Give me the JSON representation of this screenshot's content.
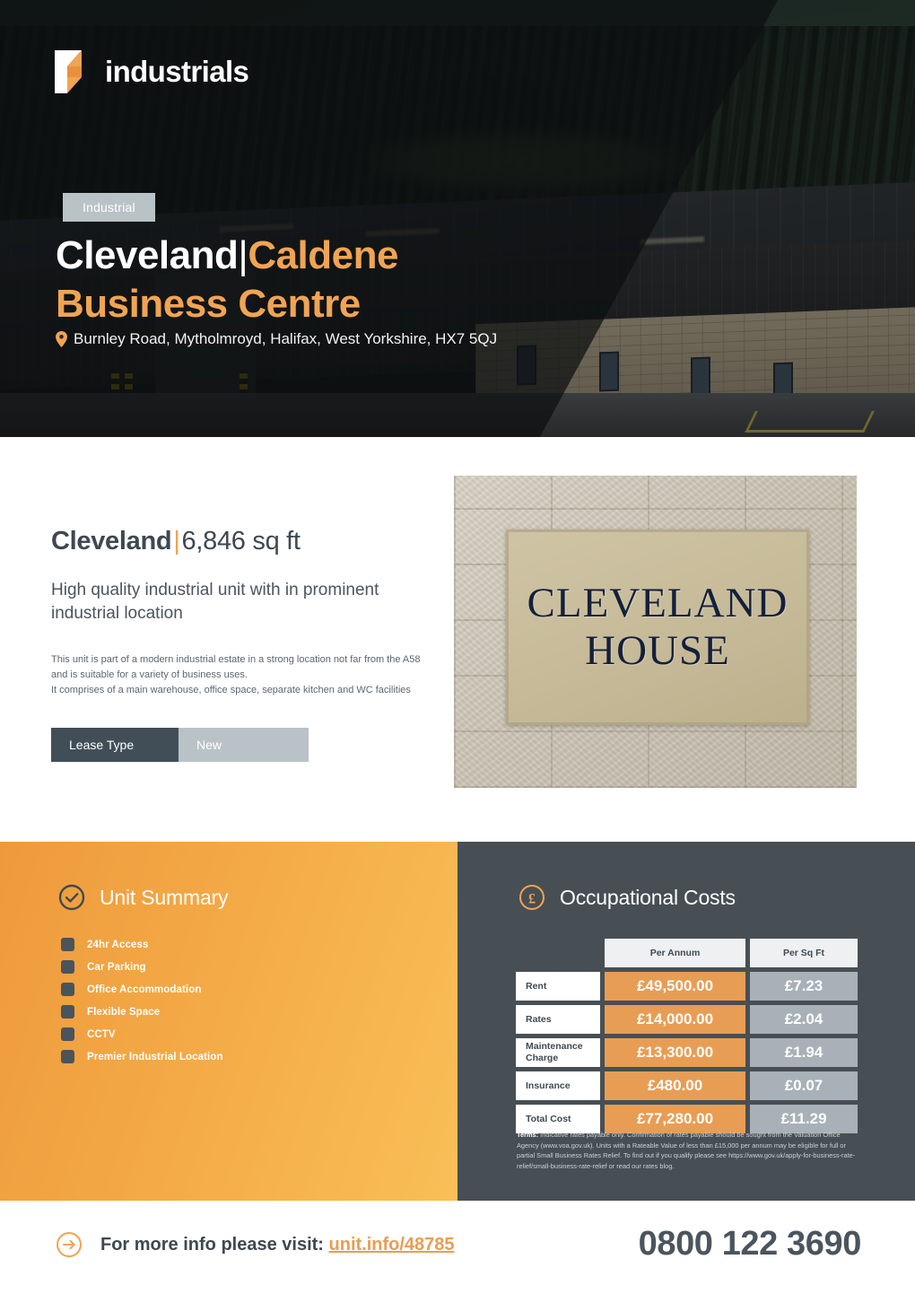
{
  "brand": {
    "name": "industrials",
    "logo_icon": "industrials-logo-icon",
    "accent_color": "#f0a454",
    "dark_color": "#474f54"
  },
  "hero": {
    "tag": "Industrial",
    "title_part1": "Cleveland",
    "title_separator": "|",
    "title_part2": "Caldene",
    "title_part3": "Business Centre",
    "address": "Burnley Road, Mytholmroyd, Halifax, West Yorkshire, HX7 5QJ",
    "pin_icon": "location-pin-icon"
  },
  "unit": {
    "name": "Cleveland",
    "separator": "|",
    "size": "6,846 sq ft",
    "subtitle": "High quality industrial unit with in prominent industrial location",
    "description_line1": "This unit is part of a modern industrial estate in a strong location not far from the A58",
    "description_line2": "and is suitable for a variety of business uses.",
    "description_line3": "It comprises of a main warehouse, office space, separate kitchen and WC facilities",
    "lease_label": "Lease Type",
    "lease_value": "New",
    "photo_caption_line1": "CLEVELAND",
    "photo_caption_line2": "HOUSE"
  },
  "summary": {
    "title": "Unit Summary",
    "icon": "check-circle-icon",
    "items": [
      {
        "label": "24hr Access"
      },
      {
        "label": "Car Parking"
      },
      {
        "label": "Office Accommodation"
      },
      {
        "label": "Flexible Space"
      },
      {
        "label": "CCTV"
      },
      {
        "label": "Premier Industrial Location"
      }
    ]
  },
  "costs": {
    "title": "Occupational Costs",
    "icon": "pound-circle-icon",
    "columns": [
      "",
      "Per Annum",
      "Per Sq Ft"
    ],
    "rows": [
      {
        "label": "Rent",
        "per_annum": "£49,500.00",
        "per_sq_ft": "£7.23"
      },
      {
        "label": "Rates",
        "per_annum": "£14,000.00",
        "per_sq_ft": "£2.04"
      },
      {
        "label": "Maintenance Charge",
        "per_annum": "£13,300.00",
        "per_sq_ft": "£1.94"
      },
      {
        "label": "Insurance",
        "per_annum": "£480.00",
        "per_sq_ft": "£0.07"
      },
      {
        "label": "Total Cost",
        "per_annum": "£77,280.00",
        "per_sq_ft": "£11.29"
      }
    ],
    "terms_heading": "Terms:",
    "terms_body": " Indicative rates payable only. Confirmation of rates payable should be sought from the Valuation Office Agency (www.voa.gov.uk). Units with a Rateable Value of less than £15,000 per annum may be eligible for full or partial Small Business Rates Relief. To find out if you qualify please see https://www.gov.uk/apply-for-business-rate-relief/small-business-rate-relief or read our rates blog."
  },
  "footer": {
    "cta_text": "For more info please visit:",
    "cta_link": "unit.info/48785",
    "arrow_icon": "arrow-right-circle-icon",
    "phone": "0800 122 3690"
  }
}
